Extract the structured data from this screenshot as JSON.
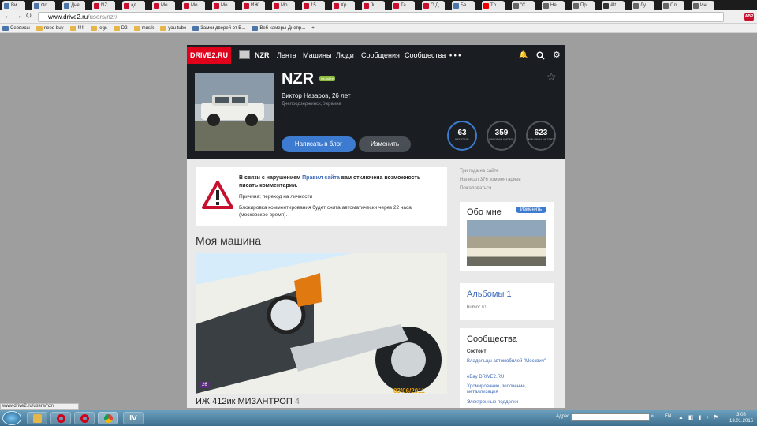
{
  "browser": {
    "tabs": [
      {
        "label": "Ви",
        "icon": "vk-icon",
        "color": "#4a76a8"
      },
      {
        "label": "Фо",
        "icon": "vk-icon",
        "color": "#4a76a8"
      },
      {
        "label": "Дне",
        "icon": "vk-icon",
        "color": "#4a76a8"
      },
      {
        "label": "NZ",
        "icon": "drive2-icon",
        "color": "#c8102e"
      },
      {
        "label": "ад",
        "icon": "drive2-icon",
        "color": "#c8102e"
      },
      {
        "label": "Мо",
        "icon": "drive2-icon",
        "color": "#c8102e"
      },
      {
        "label": "Мо",
        "icon": "drive2-icon",
        "color": "#c8102e"
      },
      {
        "label": "Мо",
        "icon": "drive2-icon",
        "color": "#c8102e"
      },
      {
        "label": "ИЖ",
        "icon": "drive2-icon",
        "color": "#c8102e"
      },
      {
        "label": "Мо",
        "icon": "drive2-icon",
        "color": "#c8102e"
      },
      {
        "label": "15",
        "icon": "drive2-icon",
        "color": "#c8102e"
      },
      {
        "label": "Хр",
        "icon": "drive2-icon",
        "color": "#c8102e"
      },
      {
        "label": "Ju",
        "icon": "drive2-icon",
        "color": "#c8102e"
      },
      {
        "label": "Та",
        "icon": "drive2-icon",
        "color": "#c8102e"
      },
      {
        "label": "О Д",
        "icon": "drive2-icon",
        "color": "#c8102e"
      },
      {
        "label": "Бе",
        "icon": "vk-icon",
        "color": "#4a76a8"
      },
      {
        "label": "Th",
        "icon": "youtube-icon",
        "color": "#e00"
      },
      {
        "label": "\"С",
        "icon": "page-icon",
        "color": "#666"
      },
      {
        "label": "Не",
        "icon": "page-icon",
        "color": "#666"
      },
      {
        "label": "Пр",
        "icon": "page-icon",
        "color": "#666"
      },
      {
        "label": "Alt",
        "icon": "wiki-icon",
        "color": "#333"
      },
      {
        "label": "Лу",
        "icon": "page-icon",
        "color": "#666"
      },
      {
        "label": "Сл",
        "icon": "page-icon",
        "color": "#666"
      },
      {
        "label": "Ин",
        "icon": "page-icon",
        "color": "#666"
      }
    ],
    "url_host": "www.drive2.ru",
    "url_path": "/users/nzr/",
    "bookmarks": [
      "Сервисы",
      "need buy",
      "!!!!!",
      "jegs",
      "D2",
      "musik",
      "you tube",
      "Замки дверей от В...",
      "Веб-камеры Днепр...",
      "+"
    ],
    "status_url": "www.drive2.ru/users/nzr/",
    "abp_label": "ABP"
  },
  "site": {
    "logo": "DRIVE2.RU",
    "nav": [
      "NZR",
      "Лента",
      "Машины",
      "Люди",
      "Сообщения",
      "Сообщества",
      "• • •"
    ],
    "accent": "#e0001b",
    "blue": "#3d7bd1"
  },
  "profile": {
    "username": "NZR",
    "online_badge": "на сайте",
    "full_name": "Виктор Назаров, 26 лет",
    "city": "Днепродзержинск, Украина",
    "write_blog": "Написать в блог",
    "edit": "Изменить",
    "stats": [
      {
        "value": "63",
        "label": "читатель"
      },
      {
        "value": "359",
        "label": "человек читает"
      },
      {
        "value": "623",
        "label": "машины читает"
      }
    ]
  },
  "notice": {
    "title_pre": "В связи с нарушением ",
    "title_link": "Правил сайта",
    "title_post": " вам отключена возможность писать комментарии.",
    "reason": "Причина: переход на личности",
    "block_info": "Блокировка комментирования будет снята автоматически через 22 часа (московское время)."
  },
  "my_car": {
    "heading": "Моя машина",
    "photo_badge": "26",
    "photo_date": "03/06/2011",
    "title": "ИЖ 412ик МИЗАНТРОП",
    "count": "4"
  },
  "sidebar": {
    "meta": [
      "Три года на сайте",
      "Написал 376 комментариев",
      "Пожаловаться"
    ],
    "about_title": "Обо мне",
    "about_edit": "Изменить",
    "albums_title": "Альбомы",
    "albums_count": "1",
    "album_item": "humor",
    "album_item_count": "61",
    "communities_title": "Сообщества",
    "communities_sub": "Состоит",
    "communities": [
      "Владельцы автомобилей \"Москвич\"",
      "eBay DRIVE2.RU",
      "Хромирование, золочение, металлизация",
      "Электронные подделки"
    ]
  },
  "taskbar": {
    "address_label": "Адрес",
    "lang": "EN",
    "time": "3:08",
    "date": "13.01.2015"
  }
}
